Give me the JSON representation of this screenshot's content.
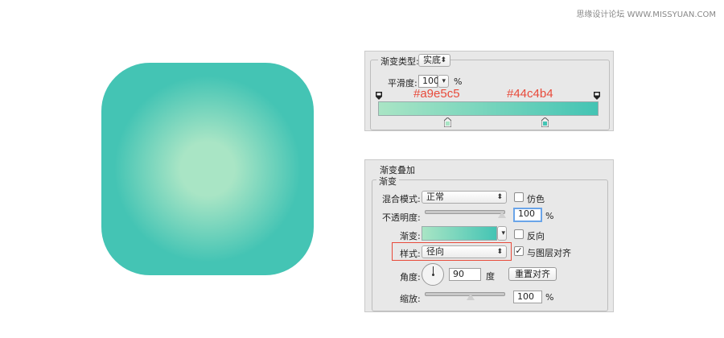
{
  "watermark": "思缘设计论坛  WWW.MISSYUAN.COM",
  "colors": {
    "start": "#a9e5c5",
    "end": "#44c4b4",
    "annotation": "#e84a3a"
  },
  "editor": {
    "type_label": "渐变类型:",
    "type_value": "实底",
    "smooth_label": "平滑度:",
    "smooth_value": "100",
    "percent": "%",
    "stop_start_hex": "#a9e5c5",
    "stop_end_hex": "#44c4b4"
  },
  "overlay": {
    "title": "渐变叠加",
    "section": "渐变",
    "blend_label": "混合模式:",
    "blend_value": "正常",
    "dither_label": "仿色",
    "opacity_label": "不透明度:",
    "opacity_value": "100",
    "percent": "%",
    "gradient_label": "渐变:",
    "reverse_label": "反向",
    "style_label": "样式:",
    "style_value": "径向",
    "align_label": "与图层对齐",
    "align_checked": true,
    "angle_label": "角度:",
    "angle_value": "90",
    "angle_unit": "度",
    "reset_label": "重置对齐",
    "scale_label": "缩放:",
    "scale_value": "100",
    "opacity_fraction": 1.0,
    "scale_fraction": 0.5
  }
}
